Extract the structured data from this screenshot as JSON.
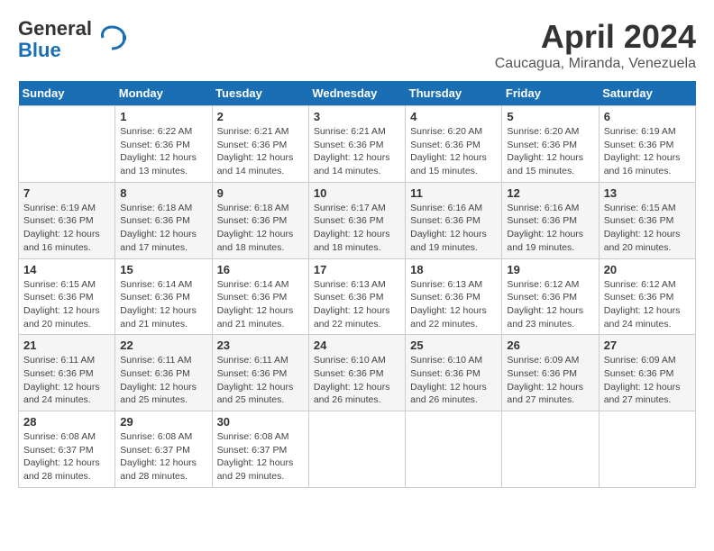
{
  "header": {
    "logo_line1": "General",
    "logo_line2": "Blue",
    "month": "April 2024",
    "location": "Caucagua, Miranda, Venezuela"
  },
  "columns": [
    "Sunday",
    "Monday",
    "Tuesday",
    "Wednesday",
    "Thursday",
    "Friday",
    "Saturday"
  ],
  "weeks": [
    [
      {
        "day": "",
        "info": ""
      },
      {
        "day": "1",
        "info": "Sunrise: 6:22 AM\nSunset: 6:36 PM\nDaylight: 12 hours\nand 13 minutes."
      },
      {
        "day": "2",
        "info": "Sunrise: 6:21 AM\nSunset: 6:36 PM\nDaylight: 12 hours\nand 14 minutes."
      },
      {
        "day": "3",
        "info": "Sunrise: 6:21 AM\nSunset: 6:36 PM\nDaylight: 12 hours\nand 14 minutes."
      },
      {
        "day": "4",
        "info": "Sunrise: 6:20 AM\nSunset: 6:36 PM\nDaylight: 12 hours\nand 15 minutes."
      },
      {
        "day": "5",
        "info": "Sunrise: 6:20 AM\nSunset: 6:36 PM\nDaylight: 12 hours\nand 15 minutes."
      },
      {
        "day": "6",
        "info": "Sunrise: 6:19 AM\nSunset: 6:36 PM\nDaylight: 12 hours\nand 16 minutes."
      }
    ],
    [
      {
        "day": "7",
        "info": "Sunrise: 6:19 AM\nSunset: 6:36 PM\nDaylight: 12 hours\nand 16 minutes."
      },
      {
        "day": "8",
        "info": "Sunrise: 6:18 AM\nSunset: 6:36 PM\nDaylight: 12 hours\nand 17 minutes."
      },
      {
        "day": "9",
        "info": "Sunrise: 6:18 AM\nSunset: 6:36 PM\nDaylight: 12 hours\nand 18 minutes."
      },
      {
        "day": "10",
        "info": "Sunrise: 6:17 AM\nSunset: 6:36 PM\nDaylight: 12 hours\nand 18 minutes."
      },
      {
        "day": "11",
        "info": "Sunrise: 6:16 AM\nSunset: 6:36 PM\nDaylight: 12 hours\nand 19 minutes."
      },
      {
        "day": "12",
        "info": "Sunrise: 6:16 AM\nSunset: 6:36 PM\nDaylight: 12 hours\nand 19 minutes."
      },
      {
        "day": "13",
        "info": "Sunrise: 6:15 AM\nSunset: 6:36 PM\nDaylight: 12 hours\nand 20 minutes."
      }
    ],
    [
      {
        "day": "14",
        "info": "Sunrise: 6:15 AM\nSunset: 6:36 PM\nDaylight: 12 hours\nand 20 minutes."
      },
      {
        "day": "15",
        "info": "Sunrise: 6:14 AM\nSunset: 6:36 PM\nDaylight: 12 hours\nand 21 minutes."
      },
      {
        "day": "16",
        "info": "Sunrise: 6:14 AM\nSunset: 6:36 PM\nDaylight: 12 hours\nand 21 minutes."
      },
      {
        "day": "17",
        "info": "Sunrise: 6:13 AM\nSunset: 6:36 PM\nDaylight: 12 hours\nand 22 minutes."
      },
      {
        "day": "18",
        "info": "Sunrise: 6:13 AM\nSunset: 6:36 PM\nDaylight: 12 hours\nand 22 minutes."
      },
      {
        "day": "19",
        "info": "Sunrise: 6:12 AM\nSunset: 6:36 PM\nDaylight: 12 hours\nand 23 minutes."
      },
      {
        "day": "20",
        "info": "Sunrise: 6:12 AM\nSunset: 6:36 PM\nDaylight: 12 hours\nand 24 minutes."
      }
    ],
    [
      {
        "day": "21",
        "info": "Sunrise: 6:11 AM\nSunset: 6:36 PM\nDaylight: 12 hours\nand 24 minutes."
      },
      {
        "day": "22",
        "info": "Sunrise: 6:11 AM\nSunset: 6:36 PM\nDaylight: 12 hours\nand 25 minutes."
      },
      {
        "day": "23",
        "info": "Sunrise: 6:11 AM\nSunset: 6:36 PM\nDaylight: 12 hours\nand 25 minutes."
      },
      {
        "day": "24",
        "info": "Sunrise: 6:10 AM\nSunset: 6:36 PM\nDaylight: 12 hours\nand 26 minutes."
      },
      {
        "day": "25",
        "info": "Sunrise: 6:10 AM\nSunset: 6:36 PM\nDaylight: 12 hours\nand 26 minutes."
      },
      {
        "day": "26",
        "info": "Sunrise: 6:09 AM\nSunset: 6:36 PM\nDaylight: 12 hours\nand 27 minutes."
      },
      {
        "day": "27",
        "info": "Sunrise: 6:09 AM\nSunset: 6:36 PM\nDaylight: 12 hours\nand 27 minutes."
      }
    ],
    [
      {
        "day": "28",
        "info": "Sunrise: 6:08 AM\nSunset: 6:37 PM\nDaylight: 12 hours\nand 28 minutes."
      },
      {
        "day": "29",
        "info": "Sunrise: 6:08 AM\nSunset: 6:37 PM\nDaylight: 12 hours\nand 28 minutes."
      },
      {
        "day": "30",
        "info": "Sunrise: 6:08 AM\nSunset: 6:37 PM\nDaylight: 12 hours\nand 29 minutes."
      },
      {
        "day": "",
        "info": ""
      },
      {
        "day": "",
        "info": ""
      },
      {
        "day": "",
        "info": ""
      },
      {
        "day": "",
        "info": ""
      }
    ]
  ]
}
